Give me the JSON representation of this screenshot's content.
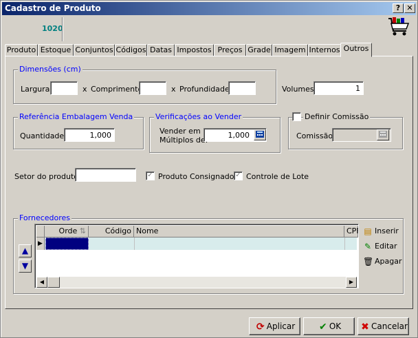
{
  "window": {
    "title": "Cadastro de Produto",
    "help": "?",
    "close": "✕"
  },
  "product_code": "1020",
  "tabs": [
    "Produto",
    "Estoque",
    "Conjuntos",
    "Códigos",
    "Datas",
    "Impostos",
    "Preços",
    "Grade",
    "Imagem",
    "Internos",
    "Outros"
  ],
  "active_tab": "Outros",
  "dimensions": {
    "title": "Dimensões (cm)",
    "width_label": "Largura:",
    "width_value": "",
    "times1": "x",
    "length_label": "Comprimento:",
    "length_value": "",
    "times2": "x",
    "depth_label": "Profundidade:",
    "depth_value": ""
  },
  "volumes": {
    "label": "Volumes:",
    "value": "1"
  },
  "packaging": {
    "title": "Referência Embalagem Venda",
    "qty_label": "Quantidade:",
    "qty_value": "1,000"
  },
  "sale_checks": {
    "title": "Verificações ao Vender",
    "label_line1": "Vender em",
    "label_line2": "Múltiplos de:",
    "value": "1,000"
  },
  "commission": {
    "title": "Definir Comissão",
    "label": "Comissão:",
    "value": "",
    "checked": false
  },
  "sector": {
    "label": "Setor do produto:",
    "value": ""
  },
  "consigned": {
    "label": "Produto Consignado",
    "checked": true
  },
  "lot_control": {
    "label": "Controle de Lote",
    "checked": true
  },
  "suppliers": {
    "title": "Fornecedores",
    "columns": [
      "Orde",
      "Código",
      "Nome",
      "CPF"
    ],
    "side_buttons": {
      "insert": "Inserir",
      "edit": "Editar",
      "delete": "Apagar"
    }
  },
  "footer": {
    "apply": "Aplicar",
    "ok": "OK",
    "cancel": "Cancelar"
  }
}
